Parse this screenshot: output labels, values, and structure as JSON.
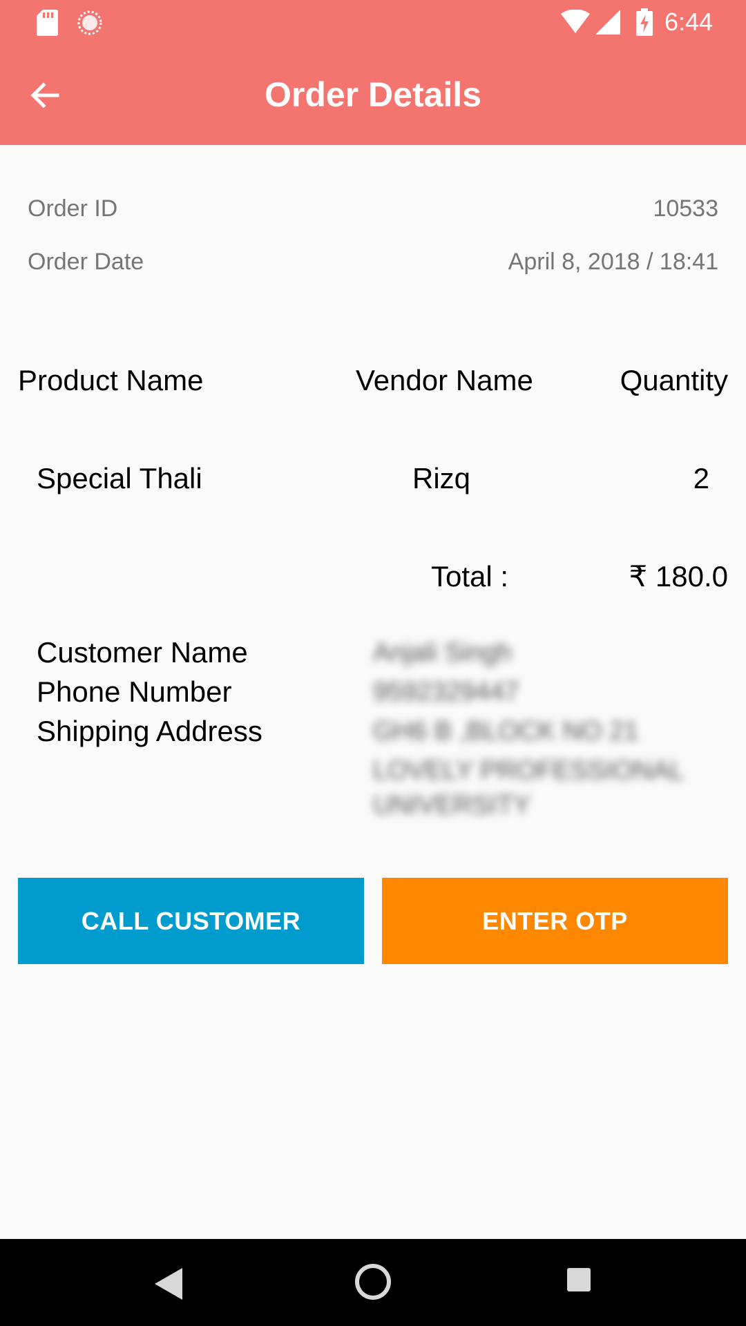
{
  "status_bar": {
    "time": "6:44",
    "icons": [
      "sd-card-icon",
      "sync-icon",
      "wifi-icon",
      "cell-signal-icon",
      "battery-charging-icon"
    ]
  },
  "app_bar": {
    "title": "Order Details",
    "back_icon": "arrow-back-icon"
  },
  "order": {
    "id_label": "Order ID",
    "id_value": "10533",
    "date_label": "Order Date",
    "date_value": "April 8, 2018 / 18:41"
  },
  "table": {
    "headers": {
      "product": "Product Name",
      "vendor": "Vendor Name",
      "quantity": "Quantity"
    },
    "rows": [
      {
        "product": "Special Thali",
        "vendor": "Rizq",
        "quantity": "2"
      }
    ],
    "total_label": "Total :",
    "total_value": "₹ 180.0"
  },
  "customer": {
    "name_label": "Customer Name",
    "phone_label": "Phone Number",
    "address_label": "Shipping Address",
    "name_value": "Anjali Singh",
    "phone_value": "9592329447",
    "address_line1": "GH6 B ,BLOCK NO 21",
    "address_line2": "LOVELY PROFESSIONAL",
    "address_line3": "UNIVERSITY"
  },
  "buttons": {
    "call": "CALL CUSTOMER",
    "otp": "ENTER OTP"
  },
  "colors": {
    "primary": "#f47470",
    "call_button": "#009ccd",
    "otp_button": "#ff8800",
    "background": "#fafafa"
  },
  "nav_bar": {
    "icons": [
      "nav-back-icon",
      "nav-home-icon",
      "nav-recents-icon"
    ]
  }
}
